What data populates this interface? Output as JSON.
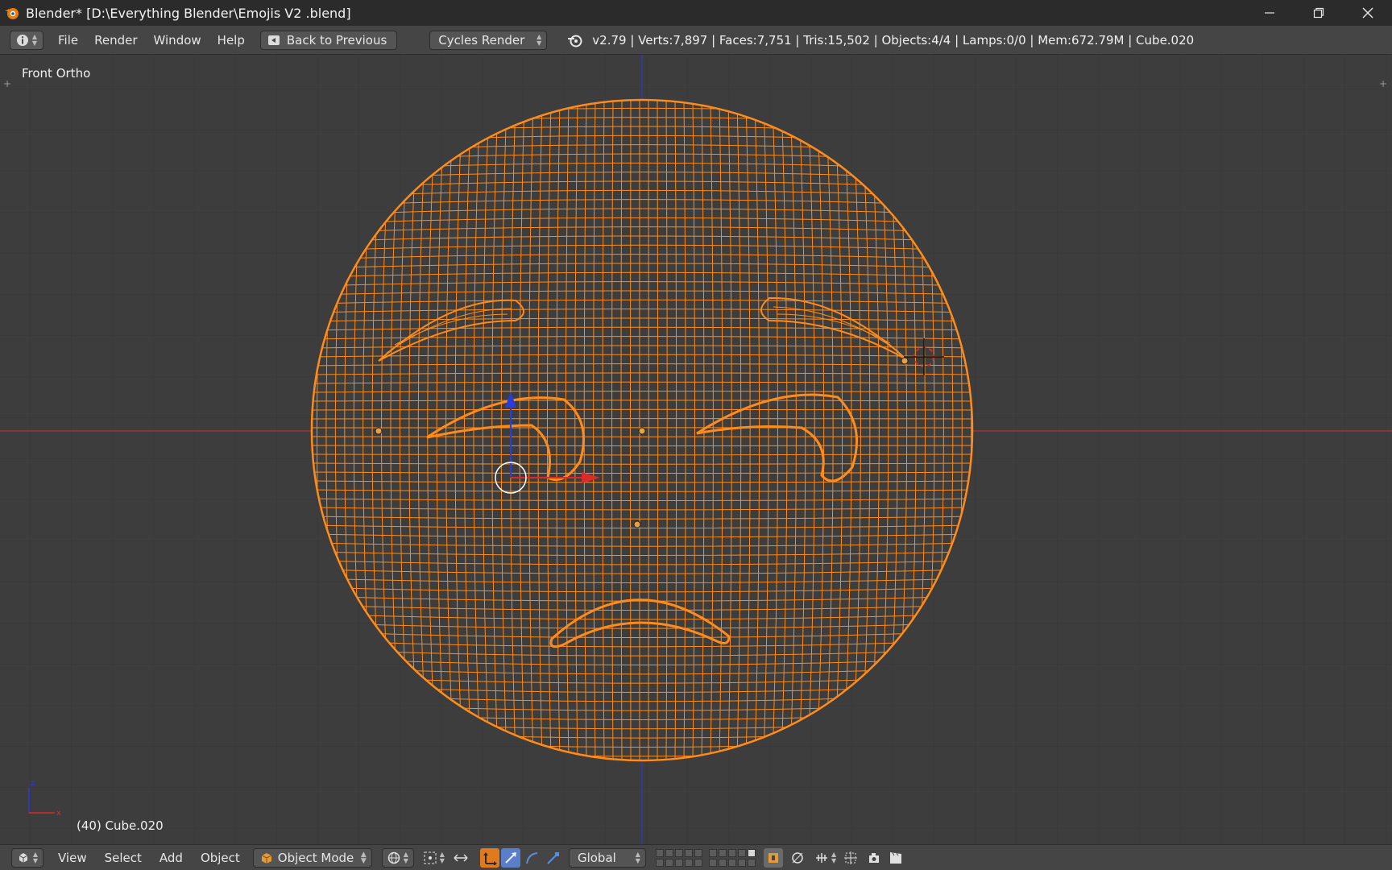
{
  "window": {
    "title": "Blender* [D:\\Everything Blender\\Emojis V2 .blend]",
    "minimize_icon": "minimize-icon",
    "maximize_icon": "restore-icon",
    "close_icon": "close-icon"
  },
  "info_header": {
    "menus": [
      "File",
      "Render",
      "Window",
      "Help"
    ],
    "back_button": "Back to Previous",
    "render_engine": "Cycles Render",
    "stats": "v2.79 | Verts:7,897 | Faces:7,751 | Tris:15,502 | Objects:4/4 | Lamps:0/0 | Mem:672.79M | Cube.020"
  },
  "viewport": {
    "view_name": "Front Ortho",
    "active_object": "(40) Cube.020",
    "wireframe_color": "#ff8c1a",
    "x_axis_color": "#c82828",
    "z_axis_color": "#2a3cc8"
  },
  "view3d_header": {
    "menus": [
      "View",
      "Select",
      "Add",
      "Object"
    ],
    "mode": "Object Mode",
    "orientation": "Global"
  },
  "colors": {
    "accent": "#e07a1e",
    "background": "#3d3d3d",
    "header": "#454545"
  }
}
